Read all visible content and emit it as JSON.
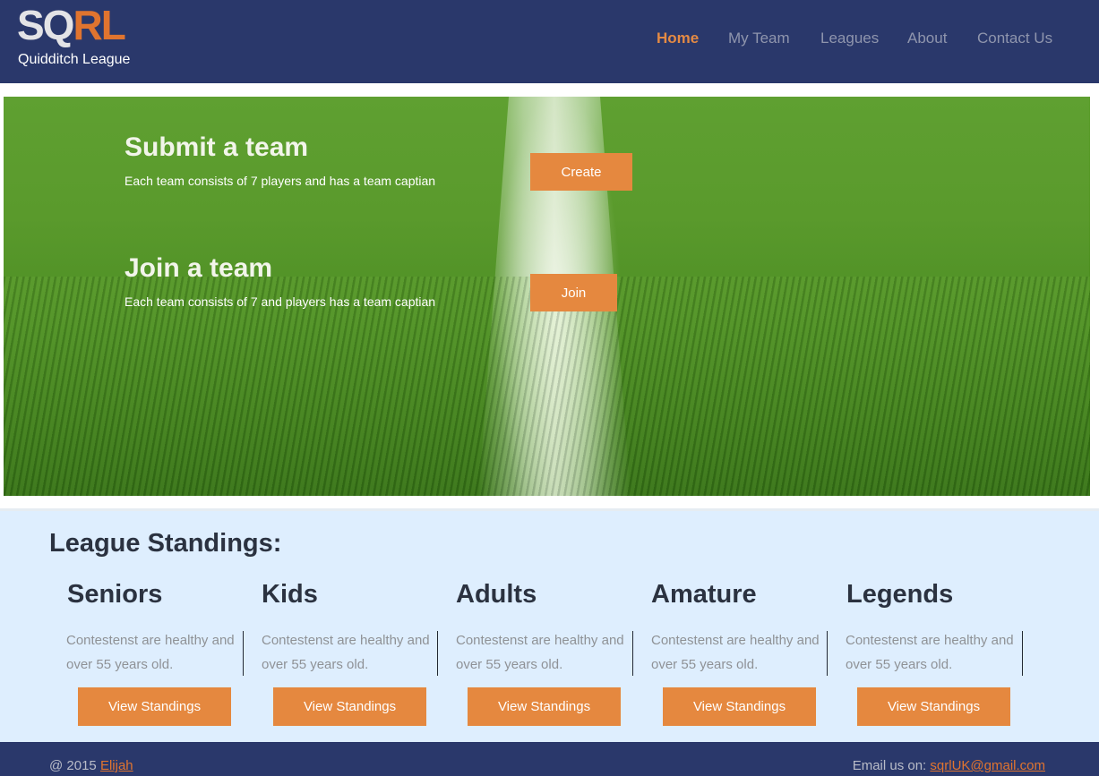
{
  "header": {
    "logo_part1": "SQ",
    "logo_part2": "RL",
    "subtitle": "Quidditch League",
    "nav": [
      {
        "label": "Home",
        "active": true
      },
      {
        "label": "My Team",
        "active": false
      },
      {
        "label": "Leagues",
        "active": false
      },
      {
        "label": "About",
        "active": false
      },
      {
        "label": "Contact Us",
        "active": false
      }
    ]
  },
  "hero": {
    "submit": {
      "title": "Submit a team",
      "text": "Each team consists of 7 players and has a team captian",
      "button": "Create"
    },
    "join": {
      "title": "Join a team",
      "text": "Each team consists of 7 and players has a team captian",
      "button": "Join"
    }
  },
  "standings": {
    "heading": "League Standings:",
    "categories": [
      {
        "title": "Seniors",
        "desc": "Contestenst are healthy and over 55 years old.",
        "button": "View Standings"
      },
      {
        "title": "Kids",
        "desc": "Contestenst are healthy and over 55 years old.",
        "button": "View Standings"
      },
      {
        "title": "Adults",
        "desc": "Contestenst are healthy and over 55 years old.",
        "button": "View Standings"
      },
      {
        "title": "Amature",
        "desc": "Contestenst are healthy and over 55 years old.",
        "button": "View Standings"
      },
      {
        "title": "Legends",
        "desc": "Contestenst are healthy and over 55 years old.",
        "button": "View Standings"
      }
    ]
  },
  "footer": {
    "copyright_prefix": "@ 2015 ",
    "author": "Elijah",
    "email_prefix": "Email us on: ",
    "email": "sqrlUK@gmail.com"
  },
  "colors": {
    "header_bg": "#2a386b",
    "accent": "#e5883f",
    "standings_bg": "#deeefe"
  }
}
